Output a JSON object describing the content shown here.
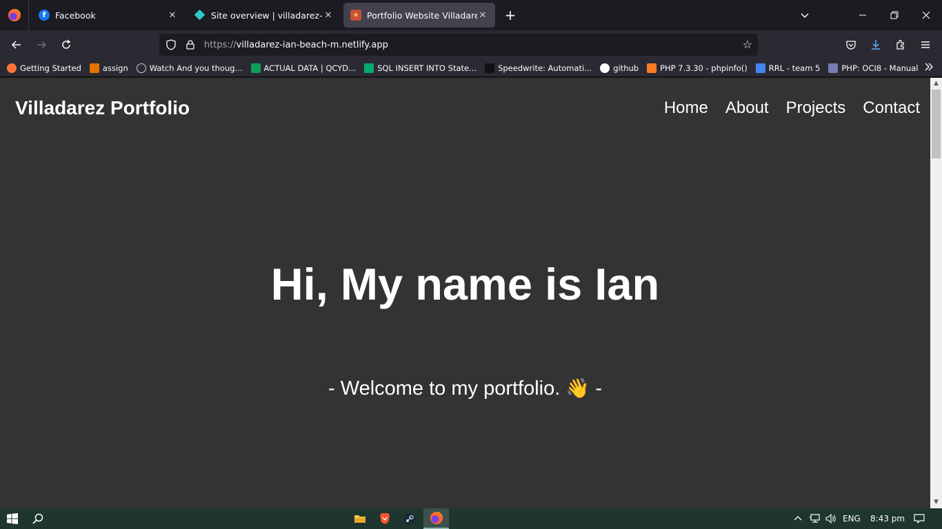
{
  "tabs": [
    {
      "title": "Facebook",
      "favicon": "facebook-icon"
    },
    {
      "title": "Site overview | villadarez-ian-be",
      "favicon": "netlify-icon"
    },
    {
      "title": "Portfolio Website Villadarez",
      "favicon": "portfolio-icon"
    }
  ],
  "address": {
    "scheme": "https://",
    "host": "villadarez-ian-beach-m.netlify.app"
  },
  "bookmarks": [
    {
      "label": "Getting Started",
      "color": "#ff7139"
    },
    {
      "label": "assign",
      "color": "#e37400"
    },
    {
      "label": "Watch And you thoug...",
      "color": "#cfcfd8"
    },
    {
      "label": "ACTUAL DATA | QCYD...",
      "color": "#0f9d58"
    },
    {
      "label": "SQL INSERT INTO State...",
      "color": "#04aa6d"
    },
    {
      "label": "Speedwrite: Automati...",
      "color": "#111111"
    },
    {
      "label": "github",
      "color": "#ffffff"
    },
    {
      "label": "PHP 7.3.30 - phpinfo()",
      "color": "#fb7a24"
    },
    {
      "label": "RRL - team 5",
      "color": "#4285f4"
    },
    {
      "label": "PHP: OCI8 - Manual",
      "color": "#777bb3"
    }
  ],
  "site": {
    "brand": "Villadarez Portfolio",
    "nav": [
      "Home",
      "About",
      "Projects",
      "Contact"
    ],
    "hero": "Hi, My name is Ian",
    "subtitle_left": "- Welcome to my portfolio.",
    "subtitle_emoji": "👋",
    "subtitle_right": "-"
  },
  "taskbar": {
    "language": "ENG",
    "time": "8:43 pm"
  },
  "colors": {
    "page_bg": "#333333",
    "chrome_bg": "#1c1b22",
    "toolbar_bg": "#2b2a33",
    "taskbar_bg": "#1f3530"
  }
}
